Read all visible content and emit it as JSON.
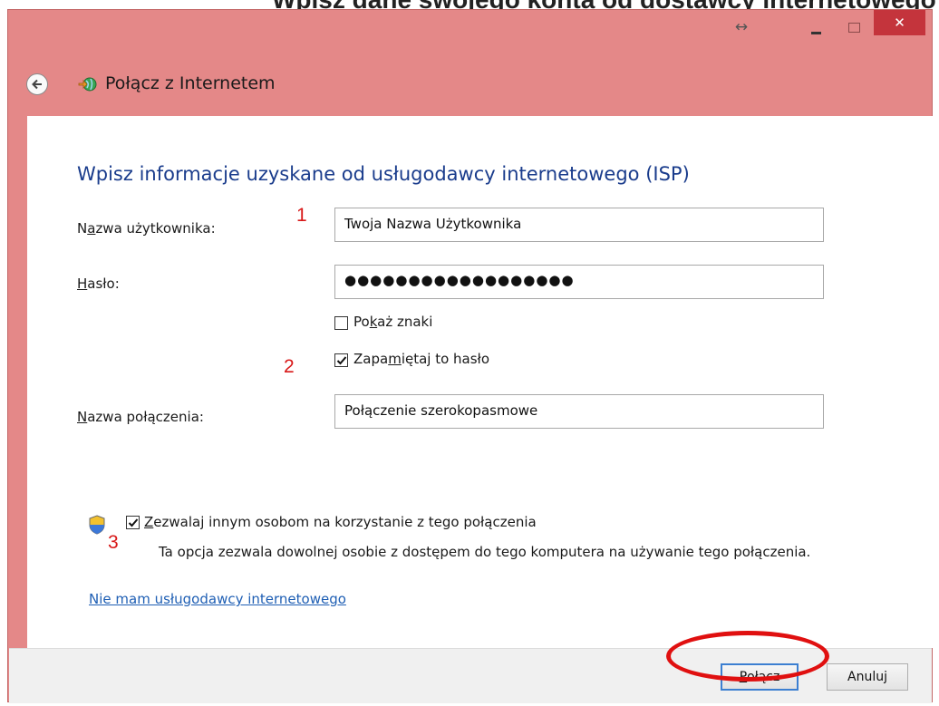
{
  "header_fragment": "Wpisz dane swojego konta od dostawcy internetowego",
  "titlebar": {
    "resize_glyph": "↔",
    "close_glyph": "✕"
  },
  "window_title": "Połącz z Internetem",
  "heading": "Wpisz informacje uzyskane od usługodawcy internetowego (ISP)",
  "form": {
    "username": {
      "label_pre": "N",
      "label_ul": "a",
      "label_post": "zwa użytkownika:",
      "value": "Twoja Nazwa Użytkownika"
    },
    "password": {
      "label_pre": "",
      "label_ul": "H",
      "label_post": "asło:",
      "value": "●●●●●●●●●●●●●●●●●●"
    },
    "show_chars": {
      "label_pre": "Po",
      "label_ul": "k",
      "label_post": "aż znaki",
      "checked": false
    },
    "remember": {
      "label_pre": "Zapa",
      "label_ul": "m",
      "label_post": "iętaj to hasło",
      "checked": true
    },
    "connection_name": {
      "label_pre": "",
      "label_ul": "N",
      "label_post": "azwa połączenia:",
      "value": "Połączenie szerokopasmowe"
    },
    "allow_others": {
      "label_pre": "",
      "label_ul": "Z",
      "label_post": "ezwalaj innym osobom na korzystanie z tego połączenia",
      "checked": true
    },
    "allow_note": "Ta opcja zezwala dowolnej osobie z dostępem do tego komputera na używanie tego połączenia."
  },
  "annotations": {
    "step1": "1",
    "step2": "2",
    "step3": "3"
  },
  "no_isp_link": "Nie mam usługodawcy internetowego",
  "buttons": {
    "connect": {
      "pre": "",
      "ul": "P",
      "post": "ołącz"
    },
    "cancel": "Anuluj"
  },
  "colors": {
    "titlebar": "#e48888",
    "close": "#c4343c",
    "heading": "#1a3c8c",
    "link": "#1f5fb4",
    "annotation": "#d81818"
  },
  "icons": [
    "back-arrow-icon",
    "network-icon",
    "shield-icon",
    "checkmark-icon"
  ]
}
